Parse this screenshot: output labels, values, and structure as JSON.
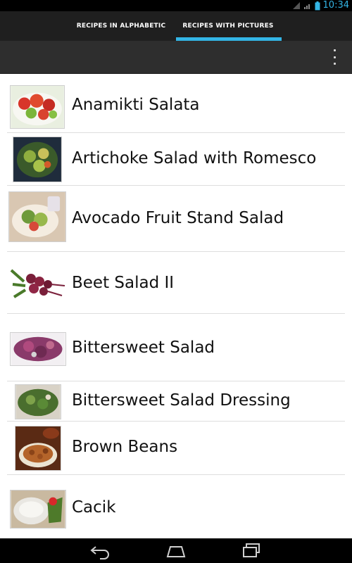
{
  "status_bar": {
    "time": "10:34",
    "icons": [
      "wifi-off-icon",
      "signal-icon",
      "battery-icon"
    ]
  },
  "tabs": [
    {
      "label": "RECIPES IN ALPHABETIC",
      "selected": false
    },
    {
      "label": "RECIPES WITH PICTURES",
      "selected": true
    }
  ],
  "action_bar": {
    "overflow_icon": "overflow-menu-icon"
  },
  "recipes": [
    {
      "label": "Anamikti Salata",
      "thumb": "salad-red-image"
    },
    {
      "label": "Artichoke Salad with Romesco",
      "thumb": "salad-artichoke-image"
    },
    {
      "label": "Avocado Fruit Stand Salad",
      "thumb": "salad-avocado-image"
    },
    {
      "label": "Beet Salad II",
      "thumb": "beets-image"
    },
    {
      "label": "Bittersweet Salad",
      "thumb": "salad-purple-image"
    },
    {
      "label": "Bittersweet Salad Dressing",
      "thumb": "salad-greens-image"
    },
    {
      "label": "Brown Beans",
      "thumb": "beans-image"
    },
    {
      "label": "Cacik",
      "thumb": "yogurt-image"
    }
  ],
  "nav_bar": {
    "buttons": [
      "back-icon",
      "home-icon",
      "recents-icon"
    ]
  },
  "colors": {
    "accent": "#33b5e5",
    "tab_bg": "#1f1f1f",
    "action_bar_bg": "#2e2e2e"
  }
}
